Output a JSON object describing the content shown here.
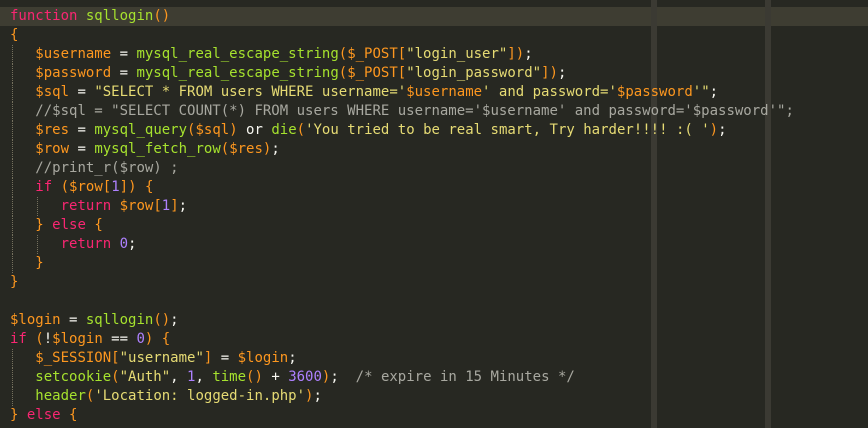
{
  "colors": {
    "background": "#272822",
    "keyword": "#f92672",
    "function": "#a6e22e",
    "variable": "#fd971f",
    "string": "#e6db74",
    "number": "#ae81ff",
    "comment": "#a8a8a0",
    "default": "#f8f8f2"
  },
  "lines": [
    {
      "indent": 0,
      "tokens": [
        [
          "kw",
          "function"
        ],
        [
          "op",
          " "
        ],
        [
          "fn",
          "sqllogin"
        ],
        [
          "br",
          "()"
        ]
      ]
    },
    {
      "indent": 0,
      "tokens": [
        [
          "br",
          "{"
        ]
      ]
    },
    {
      "indent": 1,
      "tokens": [
        [
          "op",
          "   "
        ],
        [
          "var",
          "$username"
        ],
        [
          "op",
          " = "
        ],
        [
          "fn",
          "mysql_real_escape_string"
        ],
        [
          "br",
          "("
        ],
        [
          "var",
          "$_POST"
        ],
        [
          "br",
          "["
        ],
        [
          "str",
          "\"login_user\""
        ],
        [
          "br",
          "]"
        ],
        [
          "br",
          ")"
        ],
        [
          "op",
          ";"
        ]
      ]
    },
    {
      "indent": 1,
      "tokens": [
        [
          "op",
          "   "
        ],
        [
          "var",
          "$password"
        ],
        [
          "op",
          " = "
        ],
        [
          "fn",
          "mysql_real_escape_string"
        ],
        [
          "br",
          "("
        ],
        [
          "var",
          "$_POST"
        ],
        [
          "br",
          "["
        ],
        [
          "str",
          "\"login_password\""
        ],
        [
          "br",
          "]"
        ],
        [
          "br",
          ")"
        ],
        [
          "op",
          ";"
        ]
      ]
    },
    {
      "indent": 1,
      "tokens": [
        [
          "op",
          "   "
        ],
        [
          "var",
          "$sql"
        ],
        [
          "op",
          " = "
        ],
        [
          "str",
          "\"SELECT * FROM users WHERE username='"
        ],
        [
          "var",
          "$username"
        ],
        [
          "str",
          "' and password='"
        ],
        [
          "var",
          "$password"
        ],
        [
          "str",
          "'\""
        ],
        [
          "op",
          ";"
        ]
      ]
    },
    {
      "indent": 1,
      "tokens": [
        [
          "op",
          "   "
        ],
        [
          "cm",
          "//$sql = \"SELECT COUNT(*) FROM users WHERE username='$username' and password='$password'\";"
        ]
      ]
    },
    {
      "indent": 1,
      "tokens": [
        [
          "op",
          "   "
        ],
        [
          "var",
          "$res"
        ],
        [
          "op",
          " = "
        ],
        [
          "fn",
          "mysql_query"
        ],
        [
          "br",
          "("
        ],
        [
          "var",
          "$sql"
        ],
        [
          "br",
          ")"
        ],
        [
          "op",
          " or "
        ],
        [
          "fn",
          "die"
        ],
        [
          "br",
          "("
        ],
        [
          "str",
          "'You tried to be real smart, Try harder!!!! :( '"
        ],
        [
          "br",
          ")"
        ],
        [
          "op",
          ";"
        ]
      ]
    },
    {
      "indent": 1,
      "tokens": [
        [
          "op",
          "   "
        ],
        [
          "var",
          "$row"
        ],
        [
          "op",
          " = "
        ],
        [
          "fn",
          "mysql_fetch_row"
        ],
        [
          "br",
          "("
        ],
        [
          "var",
          "$res"
        ],
        [
          "br",
          ")"
        ],
        [
          "op",
          ";"
        ]
      ]
    },
    {
      "indent": 1,
      "tokens": [
        [
          "op",
          "   "
        ],
        [
          "cm",
          "//print_r($row) ;"
        ]
      ]
    },
    {
      "indent": 1,
      "tokens": [
        [
          "op",
          "   "
        ],
        [
          "kw",
          "if"
        ],
        [
          "op",
          " "
        ],
        [
          "br",
          "("
        ],
        [
          "var",
          "$row"
        ],
        [
          "br",
          "["
        ],
        [
          "num",
          "1"
        ],
        [
          "br",
          "]"
        ],
        [
          "br",
          ")"
        ],
        [
          "op",
          " "
        ],
        [
          "br",
          "{"
        ]
      ]
    },
    {
      "indent": 2,
      "tokens": [
        [
          "op",
          "      "
        ],
        [
          "kw",
          "return"
        ],
        [
          "op",
          " "
        ],
        [
          "var",
          "$row"
        ],
        [
          "br",
          "["
        ],
        [
          "num",
          "1"
        ],
        [
          "br",
          "]"
        ],
        [
          "op",
          ";"
        ]
      ]
    },
    {
      "indent": 1,
      "tokens": [
        [
          "op",
          "   "
        ],
        [
          "br",
          "}"
        ],
        [
          "op",
          " "
        ],
        [
          "kw",
          "else"
        ],
        [
          "op",
          " "
        ],
        [
          "br",
          "{"
        ]
      ]
    },
    {
      "indent": 2,
      "tokens": [
        [
          "op",
          "      "
        ],
        [
          "kw",
          "return"
        ],
        [
          "op",
          " "
        ],
        [
          "num",
          "0"
        ],
        [
          "op",
          ";"
        ]
      ]
    },
    {
      "indent": 1,
      "tokens": [
        [
          "op",
          "   "
        ],
        [
          "br",
          "}"
        ]
      ]
    },
    {
      "indent": 0,
      "tokens": [
        [
          "br",
          "}"
        ]
      ]
    },
    {
      "indent": 0,
      "tokens": []
    },
    {
      "indent": 0,
      "tokens": [
        [
          "var",
          "$login"
        ],
        [
          "op",
          " = "
        ],
        [
          "fn",
          "sqllogin"
        ],
        [
          "br",
          "()"
        ],
        [
          "op",
          ";"
        ]
      ]
    },
    {
      "indent": 0,
      "tokens": [
        [
          "kw",
          "if"
        ],
        [
          "op",
          " "
        ],
        [
          "br",
          "("
        ],
        [
          "op",
          "!"
        ],
        [
          "var",
          "$login"
        ],
        [
          "op",
          " == "
        ],
        [
          "num",
          "0"
        ],
        [
          "br",
          ")"
        ],
        [
          "op",
          " "
        ],
        [
          "br",
          "{"
        ]
      ]
    },
    {
      "indent": 1,
      "tokens": [
        [
          "op",
          "   "
        ],
        [
          "var",
          "$_SESSION"
        ],
        [
          "br",
          "["
        ],
        [
          "str",
          "\"username\""
        ],
        [
          "br",
          "]"
        ],
        [
          "op",
          " = "
        ],
        [
          "var",
          "$login"
        ],
        [
          "op",
          ";"
        ]
      ]
    },
    {
      "indent": 1,
      "tokens": [
        [
          "op",
          "   "
        ],
        [
          "fn",
          "setcookie"
        ],
        [
          "br",
          "("
        ],
        [
          "str",
          "\"Auth\""
        ],
        [
          "op",
          ", "
        ],
        [
          "num",
          "1"
        ],
        [
          "op",
          ", "
        ],
        [
          "fn",
          "time"
        ],
        [
          "br",
          "()"
        ],
        [
          "op",
          " + "
        ],
        [
          "num",
          "3600"
        ],
        [
          "br",
          ")"
        ],
        [
          "op",
          ";  "
        ],
        [
          "cm",
          "/* expire in 15 Minutes */"
        ]
      ]
    },
    {
      "indent": 1,
      "tokens": [
        [
          "op",
          "   "
        ],
        [
          "fn",
          "header"
        ],
        [
          "br",
          "("
        ],
        [
          "str",
          "'Location: logged-in.php'"
        ],
        [
          "br",
          ")"
        ],
        [
          "op",
          ";"
        ]
      ]
    },
    {
      "indent": 0,
      "tokens": [
        [
          "br",
          "}"
        ],
        [
          "op",
          " "
        ],
        [
          "kw",
          "else"
        ],
        [
          "op",
          " "
        ],
        [
          "br",
          "{"
        ]
      ]
    }
  ]
}
